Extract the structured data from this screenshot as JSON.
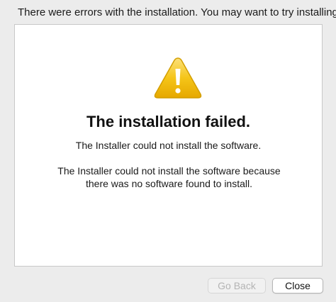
{
  "banner": {
    "text": "There were errors with the installation. You may want to try installing"
  },
  "panel": {
    "icon": "warning-icon",
    "title": "The installation failed.",
    "subtitle": "The Installer could not install the software.",
    "detail_line1": "The Installer could not install the software because",
    "detail_line2": "there was no software found to install."
  },
  "buttons": {
    "go_back": "Go Back",
    "close": "Close"
  },
  "colors": {
    "warning_fill": "#f5c518",
    "window_bg": "#ececec"
  }
}
